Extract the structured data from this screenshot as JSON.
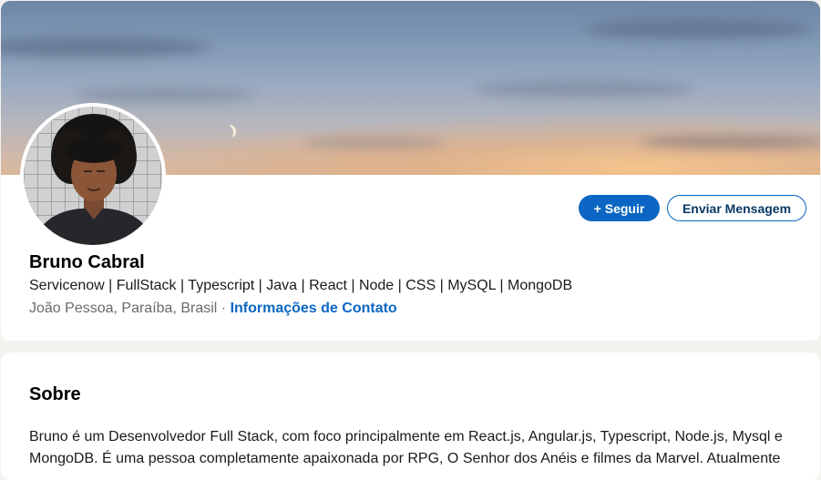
{
  "profile": {
    "banner": {
      "description_icon": "sky-banner-image"
    },
    "avatar": {
      "icon": "profile-photo"
    },
    "follow_button": "+ Seguir",
    "message_button": "Enviar Mensagem",
    "name": "Bruno Cabral",
    "headline": "Servicenow | FullStack | Typescript | Java | React | Node | CSS | MySQL | MongoDB",
    "location": "João Pessoa, Paraíba, Brasil",
    "separator": " · ",
    "contact_link": "Informações de Contato"
  },
  "about": {
    "title": "Sobre",
    "text": "Bruno é um Desenvolvedor Full Stack, com foco principalmente em React.js, Angular.js, Typescript, Node.js, Mysql e MongoDB. É uma pessoa completamente apaixonada por RPG, O Senhor dos Anéis e filmes da Marvel. Atualmente"
  },
  "colors": {
    "accent": "#0a66c2",
    "background": "#f4f2ee",
    "card": "#ffffff",
    "muted_text": "#6a6a6a"
  }
}
